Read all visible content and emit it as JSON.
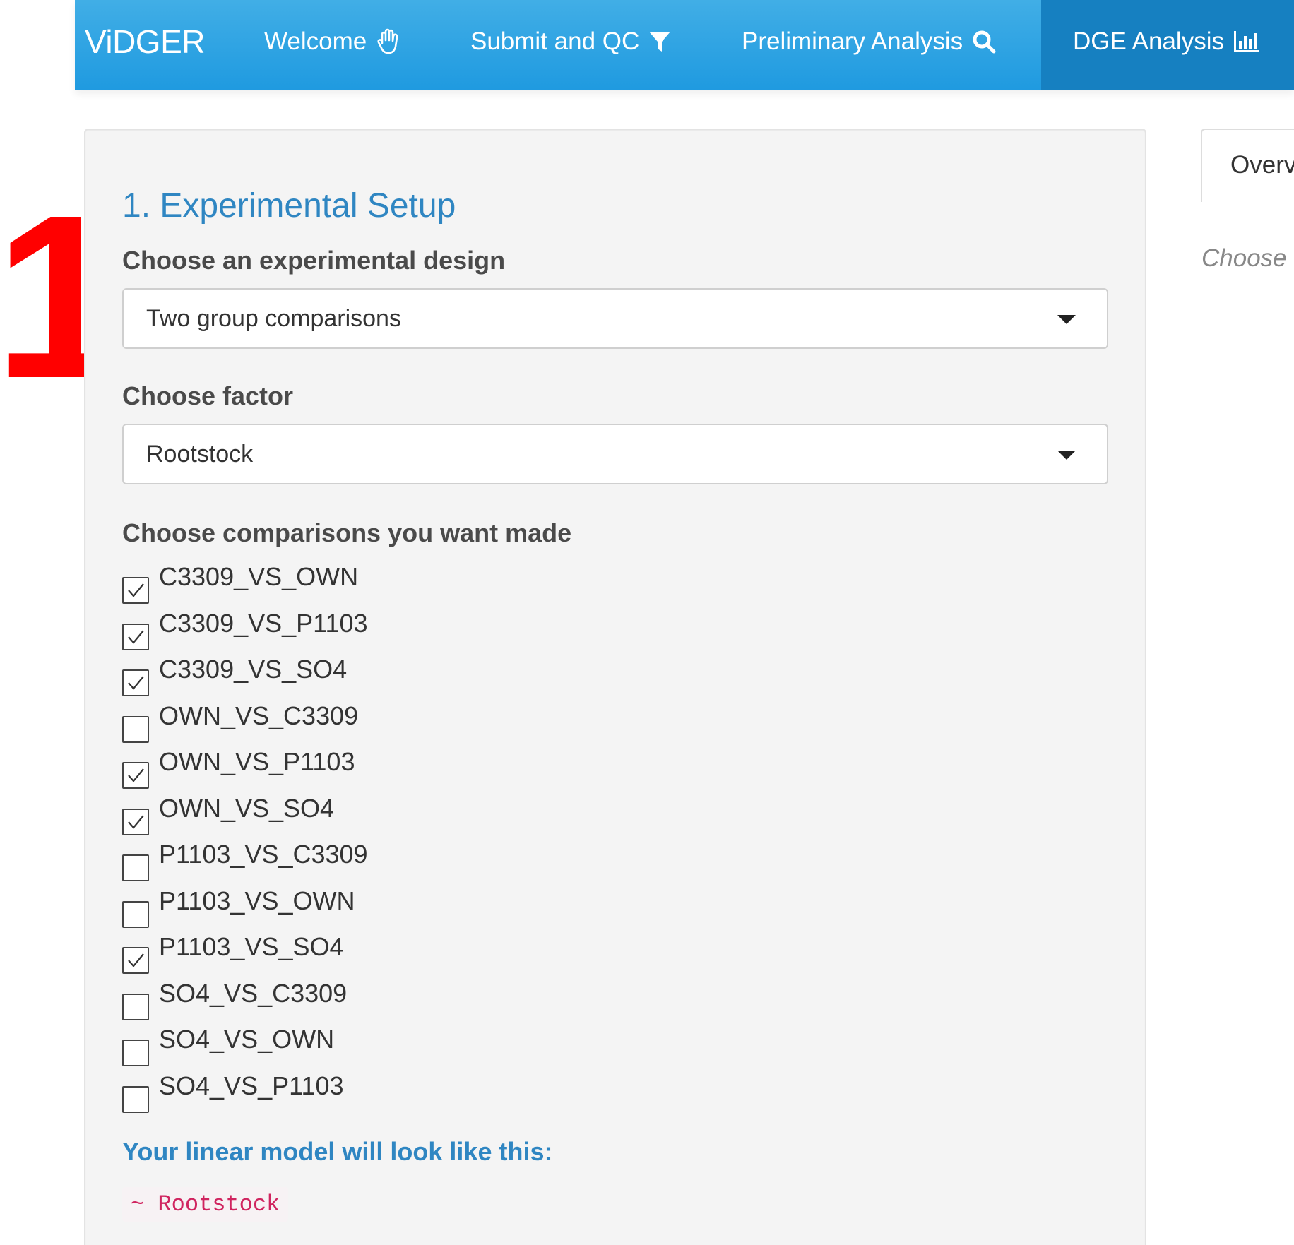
{
  "annotation": {
    "step_number": "1",
    "color": "#ff0000"
  },
  "navbar": {
    "brand": "ViDGER",
    "items": [
      {
        "label": "Welcome",
        "icon": "hand-wave-icon",
        "active": false
      },
      {
        "label": "Submit and QC",
        "icon": "filter-icon",
        "active": false
      },
      {
        "label": "Preliminary Analysis",
        "icon": "search-icon",
        "active": false
      },
      {
        "label": "DGE Analysis",
        "icon": "bar-chart-icon",
        "active": true
      }
    ],
    "colors": {
      "bar": "#2a9fd6",
      "active": "#1680c1"
    }
  },
  "setup": {
    "title": "1. Experimental Setup",
    "design_label": "Choose an experimental design",
    "design_value": "Two group comparisons",
    "factor_label": "Choose factor",
    "factor_value": "Rootstock",
    "comparisons_label": "Choose comparisons you want made",
    "comparisons": [
      {
        "label": "C3309_VS_OWN",
        "checked": true
      },
      {
        "label": "C3309_VS_P1103",
        "checked": true
      },
      {
        "label": "C3309_VS_SO4",
        "checked": true
      },
      {
        "label": "OWN_VS_C3309",
        "checked": false
      },
      {
        "label": "OWN_VS_P1103",
        "checked": true
      },
      {
        "label": "OWN_VS_SO4",
        "checked": true
      },
      {
        "label": "P1103_VS_C3309",
        "checked": false
      },
      {
        "label": "P1103_VS_OWN",
        "checked": false
      },
      {
        "label": "P1103_VS_SO4",
        "checked": true
      },
      {
        "label": "SO4_VS_C3309",
        "checked": false
      },
      {
        "label": "SO4_VS_OWN",
        "checked": false
      },
      {
        "label": "SO4_VS_P1103",
        "checked": false
      }
    ],
    "model_label": "Your linear model will look like this:",
    "model_formula": "~ Rootstock"
  },
  "right_panel": {
    "tab_label": "Overv",
    "hint": "Choose"
  }
}
